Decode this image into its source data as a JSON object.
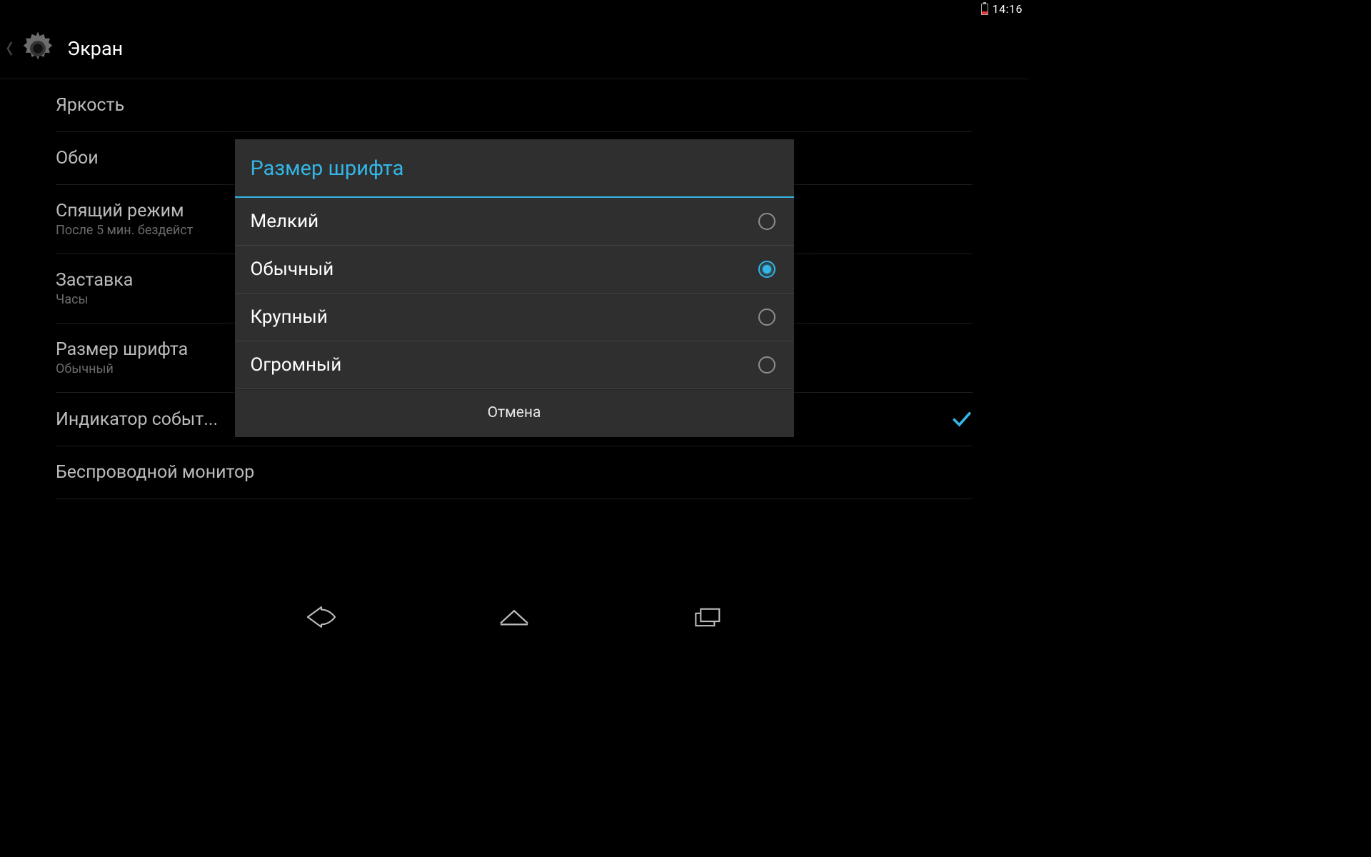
{
  "status": {
    "time": "14:16"
  },
  "header": {
    "title": "Экран"
  },
  "settings": [
    {
      "title": "Яркость",
      "sub": ""
    },
    {
      "title": "Обои",
      "sub": ""
    },
    {
      "title": "Спящий режим",
      "sub": "После 5 мин. бездейст"
    },
    {
      "title": "Заставка",
      "sub": "Часы"
    },
    {
      "title": "Размер шрифта",
      "sub": "Обычный"
    },
    {
      "title": "Индикатор событ...",
      "sub": "",
      "checked": true
    },
    {
      "title": "Беспроводной монитор",
      "sub": ""
    }
  ],
  "dialog": {
    "title": "Размер шрифта",
    "options": [
      {
        "label": "Мелкий",
        "selected": false
      },
      {
        "label": "Обычный",
        "selected": true
      },
      {
        "label": "Крупный",
        "selected": false
      },
      {
        "label": "Огромный",
        "selected": false
      }
    ],
    "cancel": "Отмена"
  },
  "colors": {
    "accent": "#33b5e5"
  }
}
